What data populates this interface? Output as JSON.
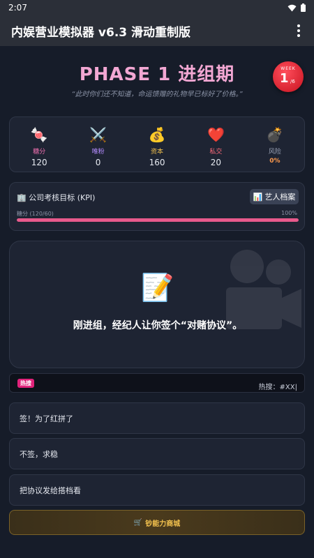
{
  "status_bar": {
    "time": "2:07"
  },
  "app_bar": {
    "title": "内娱营业模拟器 v6.3 滑动重制版"
  },
  "phase": {
    "title": "PHASE 1 进组期",
    "quote": "“此时你们还不知道，命运馈赠的礼物早已标好了价格。”",
    "week_label": "WEEK",
    "week_current": "1",
    "week_total": "/6"
  },
  "stats": [
    {
      "icon": "candy-icon",
      "glyph": "🍬",
      "label": "糖分",
      "value": "120",
      "color": "#f06fb0"
    },
    {
      "icon": "crossed-swords-icon",
      "glyph": "⚔️",
      "label": "唯粉",
      "value": "0",
      "color": "#b58cff"
    },
    {
      "icon": "money-bag-icon",
      "glyph": "💰",
      "label": "资本",
      "value": "160",
      "color": "#f2c14e"
    },
    {
      "icon": "heart-icon",
      "glyph": "❤️",
      "label": "私交",
      "value": "20",
      "color": "#ff6b7a"
    },
    {
      "icon": "bomb-icon",
      "glyph": "💣",
      "label": "风险",
      "value": "0%",
      "color": "#9aa2b5"
    }
  ],
  "kpi": {
    "title": "🏢 公司考核目标 (KPI)",
    "archive_button": "艺人档案",
    "progress_label": "糖分 (120/60)",
    "progress_percent": "100%",
    "progress_value": 1.0
  },
  "scene": {
    "emoji": "📝",
    "text": "刚进组，经纪人让你签个“对赌协议”。"
  },
  "news": {
    "tag": "热搜",
    "text": "热搜：#XX|"
  },
  "choices": [
    "签！为了红拼了",
    "不签，求稳",
    "把协议发给搭档看"
  ],
  "shop": {
    "label": "钞能力商城"
  }
}
